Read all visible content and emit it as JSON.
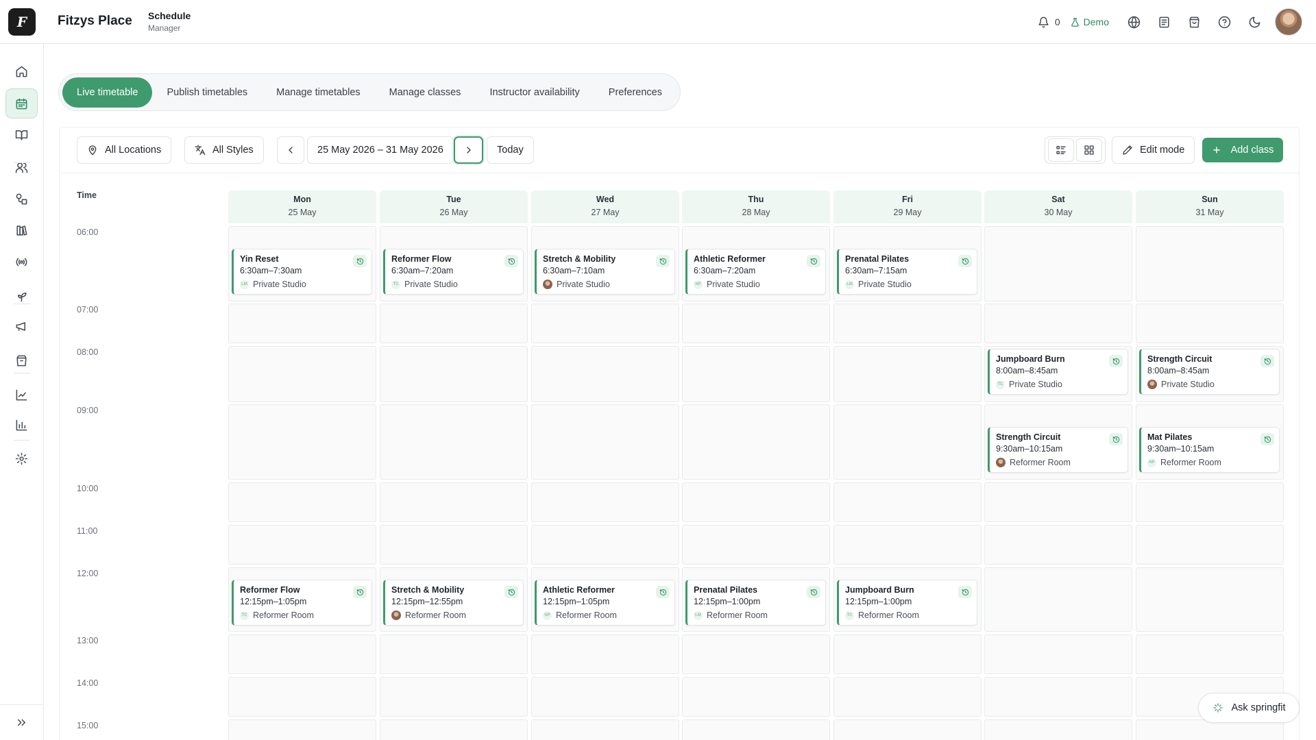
{
  "header": {
    "logo_letter": "F",
    "brand": "Fitzys Place",
    "section_title": "Schedule",
    "section_subtitle": "Manager",
    "notifications_count": "0",
    "demo_label": "Demo",
    "icons": [
      "bell-icon",
      "flask-icon",
      "globe-icon",
      "clipboard-icon",
      "shopping-bag-icon",
      "help-icon",
      "moon-icon"
    ]
  },
  "sidebar": {
    "items": [
      "home",
      "schedule",
      "book-open",
      "users",
      "shapes",
      "library",
      "broadcast",
      "plant",
      "megaphone",
      "package",
      "chart-line",
      "bar-chart",
      "settings"
    ],
    "active": "schedule",
    "expand_icon": "chevrons-right-icon"
  },
  "tabs": [
    {
      "label": "Live timetable",
      "active": true
    },
    {
      "label": "Publish timetables",
      "active": false
    },
    {
      "label": "Manage timetables",
      "active": false
    },
    {
      "label": "Manage classes",
      "active": false
    },
    {
      "label": "Instructor availability",
      "active": false
    },
    {
      "label": "Preferences",
      "active": false
    }
  ],
  "toolbar": {
    "locations": "All Locations",
    "styles": "All Styles",
    "date_range": "25 May 2026 – 31 May 2026",
    "today": "Today",
    "edit_mode": "Edit mode",
    "add_class": "Add class"
  },
  "grid": {
    "time_header": "Time",
    "days": [
      {
        "name": "Mon",
        "date": "25 May"
      },
      {
        "name": "Tue",
        "date": "26 May"
      },
      {
        "name": "Wed",
        "date": "27 May"
      },
      {
        "name": "Thu",
        "date": "28 May"
      },
      {
        "name": "Fri",
        "date": "29 May"
      },
      {
        "name": "Sat",
        "date": "30 May"
      },
      {
        "name": "Sun",
        "date": "31 May"
      }
    ],
    "hours": [
      "06:00",
      "07:00",
      "08:00",
      "09:00",
      "10:00",
      "11:00",
      "12:00",
      "13:00",
      "14:00",
      "15:00"
    ]
  },
  "events": [
    {
      "day": 0,
      "hour": 0,
      "title": "Yin Reset",
      "time": "6:30am–7:30am",
      "location": "Private Studio",
      "instructor": "LM"
    },
    {
      "day": 1,
      "hour": 0,
      "title": "Reformer Flow",
      "time": "6:30am–7:20am",
      "location": "Private Studio",
      "instructor": "TC"
    },
    {
      "day": 2,
      "hour": 0,
      "title": "Stretch & Mobility",
      "time": "6:30am–7:10am",
      "location": "Private Studio",
      "instructor": "photo"
    },
    {
      "day": 3,
      "hour": 0,
      "title": "Athletic Reformer",
      "time": "6:30am–7:20am",
      "location": "Private Studio",
      "instructor": "NP"
    },
    {
      "day": 4,
      "hour": 0,
      "title": "Prenatal Pilates",
      "time": "6:30am–7:15am",
      "location": "Private Studio",
      "instructor": "LM"
    },
    {
      "day": 5,
      "hour": 2,
      "title": "Jumpboard Burn",
      "time": "8:00am–8:45am",
      "location": "Private Studio",
      "instructor": "TC"
    },
    {
      "day": 6,
      "hour": 2,
      "title": "Strength Circuit",
      "time": "8:00am–8:45am",
      "location": "Private Studio",
      "instructor": "photo"
    },
    {
      "day": 5,
      "hour": 3,
      "title": "Strength Circuit",
      "time": "9:30am–10:15am",
      "location": "Reformer Room",
      "instructor": "photo"
    },
    {
      "day": 6,
      "hour": 3,
      "title": "Mat Pilates",
      "time": "9:30am–10:15am",
      "location": "Reformer Room",
      "instructor": "NP"
    },
    {
      "day": 0,
      "hour": 6,
      "title": "Reformer Flow",
      "time": "12:15pm–1:05pm",
      "location": "Reformer Room",
      "instructor": "TC"
    },
    {
      "day": 1,
      "hour": 6,
      "title": "Stretch & Mobility",
      "time": "12:15pm–12:55pm",
      "location": "Reformer Room",
      "instructor": "photo"
    },
    {
      "day": 2,
      "hour": 6,
      "title": "Athletic Reformer",
      "time": "12:15pm–1:05pm",
      "location": "Reformer Room",
      "instructor": "NP"
    },
    {
      "day": 3,
      "hour": 6,
      "title": "Prenatal Pilates",
      "time": "12:15pm–1:00pm",
      "location": "Reformer Room",
      "instructor": "LM"
    },
    {
      "day": 4,
      "hour": 6,
      "title": "Jumpboard Burn",
      "time": "12:15pm–1:00pm",
      "location": "Reformer Room",
      "instructor": "TC"
    }
  ],
  "assistant": {
    "label": "Ask springfit"
  },
  "colors": {
    "accent": "#3f9a6d",
    "accent_light": "#e5f4ec",
    "day_header_bg": "#eef7f2"
  }
}
